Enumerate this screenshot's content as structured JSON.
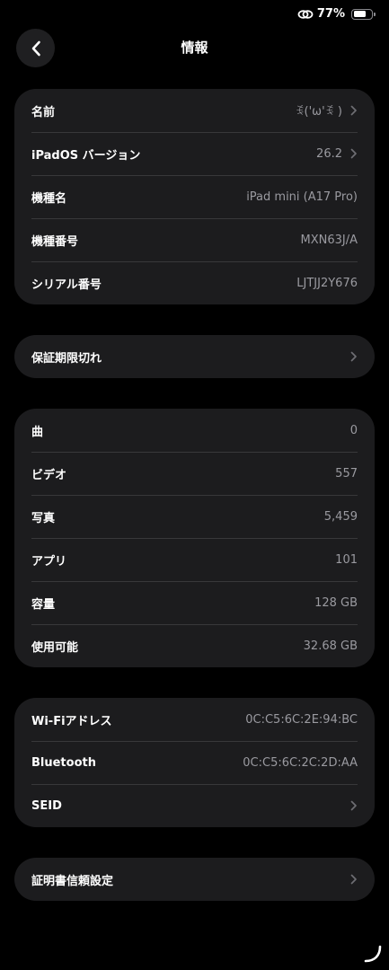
{
  "status_bar": {
    "battery_percent": "77%",
    "battery_level": 0.77,
    "icons": [
      "link-icon",
      "battery-icon"
    ]
  },
  "nav": {
    "title": "情報",
    "back_icon": "chevron-left-icon"
  },
  "device_info": {
    "rows": [
      {
        "label": "名前",
        "value": "ꉂ('ω'ꉂ )",
        "chevron": true
      },
      {
        "label": "iPadOS バージョン",
        "value": "26.2",
        "chevron": true
      },
      {
        "label": "機種名",
        "value": "iPad mini (A17 Pro)",
        "chevron": false
      },
      {
        "label": "機種番号",
        "value": "MXN63J/A",
        "chevron": false
      },
      {
        "label": "シリアル番号",
        "value": "LJTJJ2Y676",
        "chevron": false
      }
    ]
  },
  "warranty": {
    "label": "保証期限切れ"
  },
  "media": {
    "rows": [
      {
        "label": "曲",
        "value": "0"
      },
      {
        "label": "ビデオ",
        "value": "557"
      },
      {
        "label": "写真",
        "value": "5,459"
      },
      {
        "label": "アプリ",
        "value": "101"
      },
      {
        "label": "容量",
        "value": "128 GB"
      },
      {
        "label": "使用可能",
        "value": "32.68 GB"
      }
    ]
  },
  "network": {
    "rows": [
      {
        "label": "Wi-Fiアドレス",
        "value": "0C:C5:6C:2E:94:BC"
      },
      {
        "label": "Bluetooth",
        "value": "0C:C5:6C:2C:2D:AA"
      },
      {
        "label": "SEID",
        "value": ""
      }
    ]
  },
  "certificate": {
    "label": "証明書信頼設定"
  },
  "colors": {
    "background": "#000000",
    "group_background": "#1c1c1e",
    "secondary_text": "#9a9aa0",
    "separator": "#38383a"
  }
}
